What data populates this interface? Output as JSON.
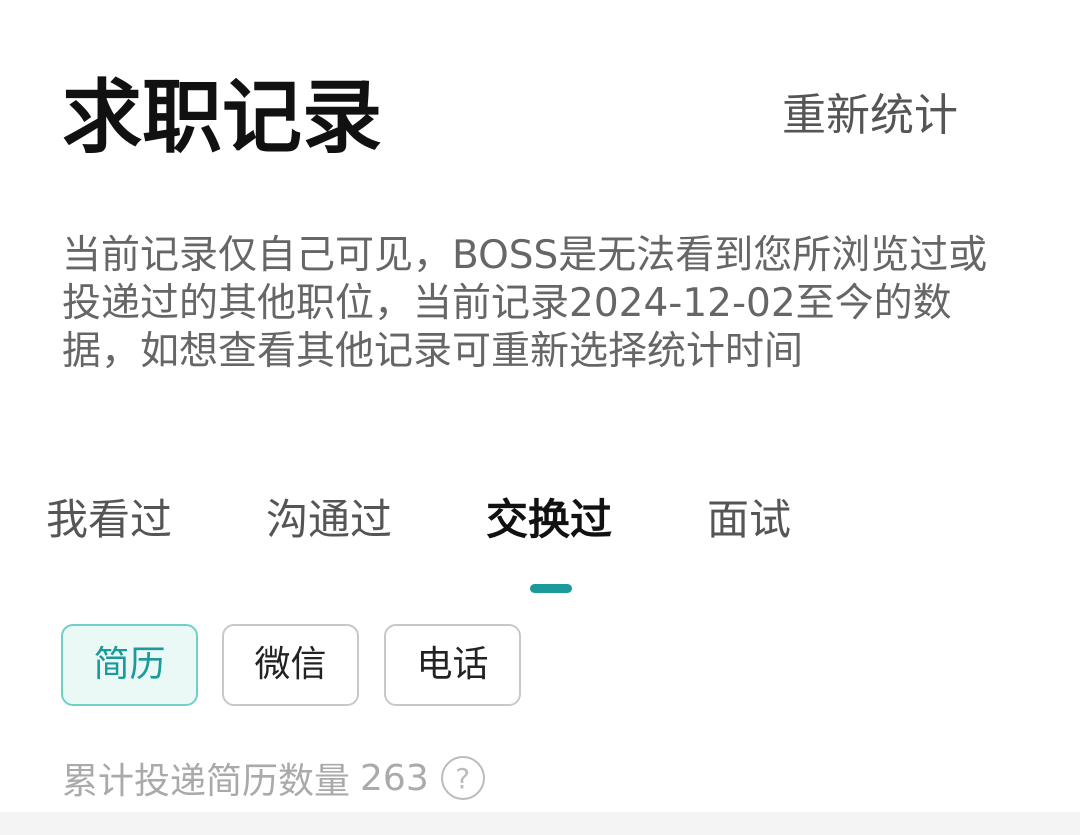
{
  "header": {
    "title": "求职记录",
    "recount_label": "重新统计"
  },
  "notice": {
    "text": "当前记录仅自己可见，BOSS是无法看到您所浏览过或投递过的其他职位，当前记录2024-12-02至今的数据，如想查看其他记录可重新选择统计时间"
  },
  "tabs": [
    {
      "label": "我看过",
      "active": false
    },
    {
      "label": "沟通过",
      "active": false
    },
    {
      "label": "交换过",
      "active": true
    },
    {
      "label": "面试",
      "active": false
    }
  ],
  "chips": [
    {
      "label": "简历",
      "active": true
    },
    {
      "label": "微信",
      "active": false
    },
    {
      "label": "电话",
      "active": false
    }
  ],
  "summary": {
    "label": "累计投递简历数量",
    "count": "263",
    "help_icon": "question-circle-icon"
  },
  "colors": {
    "accent": "#1a9a9a",
    "chip_active_bg": "#eaf8f6",
    "chip_active_border": "#6fd0c7"
  }
}
